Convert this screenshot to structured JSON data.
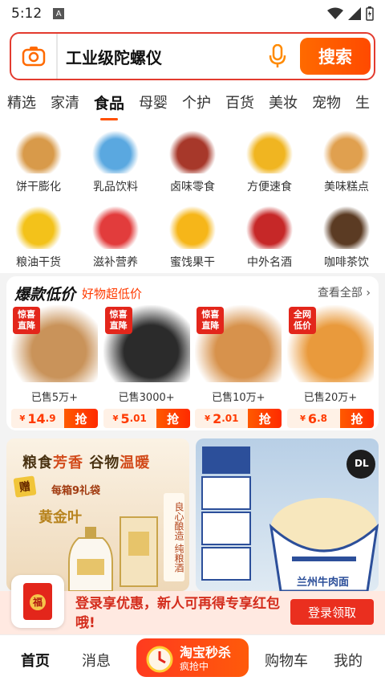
{
  "status_bar": {
    "time": "5:12",
    "sim_icon": "A"
  },
  "search": {
    "query": "工业级陀螺仪",
    "button": "搜索"
  },
  "tabs": [
    {
      "label": "精选"
    },
    {
      "label": "家清"
    },
    {
      "label": "食品",
      "active": true
    },
    {
      "label": "母婴"
    },
    {
      "label": "个护"
    },
    {
      "label": "百货"
    },
    {
      "label": "美妆"
    },
    {
      "label": "宠物"
    },
    {
      "label": "生"
    }
  ],
  "categories": [
    {
      "label": "饼干膨化",
      "icon": "cookie-icon",
      "color": "#d89a4a"
    },
    {
      "label": "乳品饮料",
      "icon": "milk-icon",
      "color": "#5aa8e0"
    },
    {
      "label": "卤味零食",
      "icon": "duck-neck-icon",
      "color": "#a7382a"
    },
    {
      "label": "方便速食",
      "icon": "instant-noodle-icon",
      "color": "#f0b521"
    },
    {
      "label": "美味糕点",
      "icon": "pastry-icon",
      "color": "#e0a04f"
    },
    {
      "label": "粮油干货",
      "icon": "oil-icon",
      "color": "#f3c21a"
    },
    {
      "label": "滋补营养",
      "icon": "nutrition-jar-icon",
      "color": "#e23c3c"
    },
    {
      "label": "蜜饯果干",
      "icon": "dried-mango-icon",
      "color": "#f6b619"
    },
    {
      "label": "中外名酒",
      "icon": "liquor-icon",
      "color": "#c62828"
    },
    {
      "label": "咖啡茶饮",
      "icon": "coffee-icon",
      "color": "#5b3b23"
    }
  ],
  "deals": {
    "title": "爆款低价",
    "subtitle": "好物超低价",
    "more": "查看全部",
    "items": [
      {
        "badge": "惊喜直降",
        "sold": "已售5万+",
        "price_int": "14",
        "price_dec": ".9",
        "currency": "¥",
        "cta": "抢",
        "color": "#c9935a"
      },
      {
        "badge": "惊喜直降",
        "sold": "已售3000+",
        "price_int": "5",
        "price_dec": ".01",
        "currency": "¥",
        "cta": "抢",
        "color": "#2b2b2b"
      },
      {
        "badge": "惊喜直降",
        "sold": "已售10万+",
        "price_int": "2",
        "price_dec": ".01",
        "currency": "¥",
        "cta": "抢",
        "color": "#d7924c"
      },
      {
        "badge": "全网低价",
        "sold": "已售20万+",
        "price_int": "6",
        "price_dec": ".8",
        "currency": "¥",
        "cta": "抢",
        "color": "#e99a3c"
      }
    ]
  },
  "banner_left": {
    "slogan_a": "粮食",
    "slogan_b": "芳香",
    "slogan_c": "谷物",
    "slogan_d": "温暖",
    "gift": "赠",
    "gift_note": "每箱9礼袋",
    "brand": "黄金叶",
    "vertical": "良心酿造 纯粮酒"
  },
  "banner_right": {
    "label": "兰州牛肉面",
    "seal": "DL"
  },
  "promo": {
    "text": "登录享优惠，新人可再得专享红包哦!",
    "button": "登录领取",
    "icon_char": "福"
  },
  "bottom_nav": {
    "home": "首页",
    "messages": "消息",
    "seckill_title": "淘宝秒杀",
    "seckill_sub": "疯抢中",
    "cart": "购物车",
    "mine": "我的"
  }
}
